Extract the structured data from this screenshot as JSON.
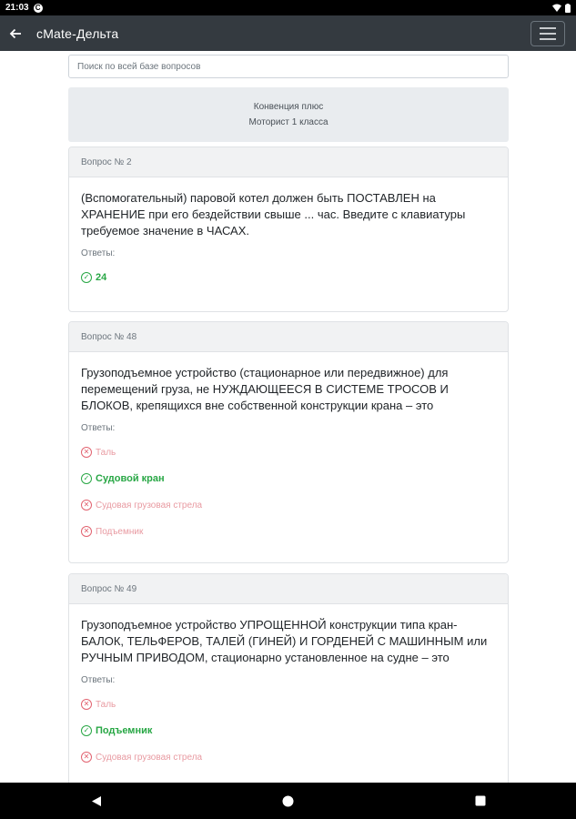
{
  "status_bar": {
    "time": "21:03",
    "notification_icon": "app-notification-icon"
  },
  "app_bar": {
    "title": "cMate-Дельта"
  },
  "search": {
    "placeholder": "Поиск по всей базе вопросов"
  },
  "header": {
    "line1": "Конвенция плюс",
    "line2": "Моторист 1 класса"
  },
  "questions": [
    {
      "number_label": "Вопрос № 2",
      "text": "(Вспомогательный) паровой котел должен быть ПОСТАВЛЕН на ХРАНЕНИЕ при его бездействии свыше ... час. Введите с клавиатуры требуемое значение в ЧАСАХ.",
      "answers_label": "Ответы:",
      "answers": [
        {
          "text": "24",
          "correct": true
        }
      ]
    },
    {
      "number_label": "Вопрос № 48",
      "text": "Грузоподъемное устройство (стационарное или передвижное) для перемещений груза, не НУЖДАЮЩЕЕСЯ В СИСТЕМЕ ТРОСОВ И БЛОКОВ, крепящихся вне собственной конструкции крана – это",
      "answers_label": "Ответы:",
      "answers": [
        {
          "text": "Таль",
          "correct": false
        },
        {
          "text": "Судовой кран",
          "correct": true
        },
        {
          "text": "Судовая грузовая стрела",
          "correct": false
        },
        {
          "text": "Подъемник",
          "correct": false
        }
      ]
    },
    {
      "number_label": "Вопрос № 49",
      "text": "Грузоподъемное устройство УПРОЩЕННОЙ конструкции типа кран-БАЛОК, ТЕЛЬФЕРОВ, ТАЛЕЙ (ГИНЕЙ) И ГОРДЕНЕЙ С МАШИННЫМ или РУЧНЫМ ПРИВОДОМ, стационарно установленное на судне – это",
      "answers_label": "Ответы:",
      "answers": [
        {
          "text": "Таль",
          "correct": false
        },
        {
          "text": "Подъемник",
          "correct": true
        },
        {
          "text": "Судовая грузовая стрела",
          "correct": false
        }
      ]
    }
  ],
  "icons": {
    "correct": "check-circle-icon",
    "wrong": "x-circle-icon",
    "back": "arrow-left-icon",
    "menu": "hamburger-menu-icon"
  },
  "colors": {
    "app_bar": "#343a40",
    "correct": "#28a745",
    "wrong": "#e26370"
  }
}
